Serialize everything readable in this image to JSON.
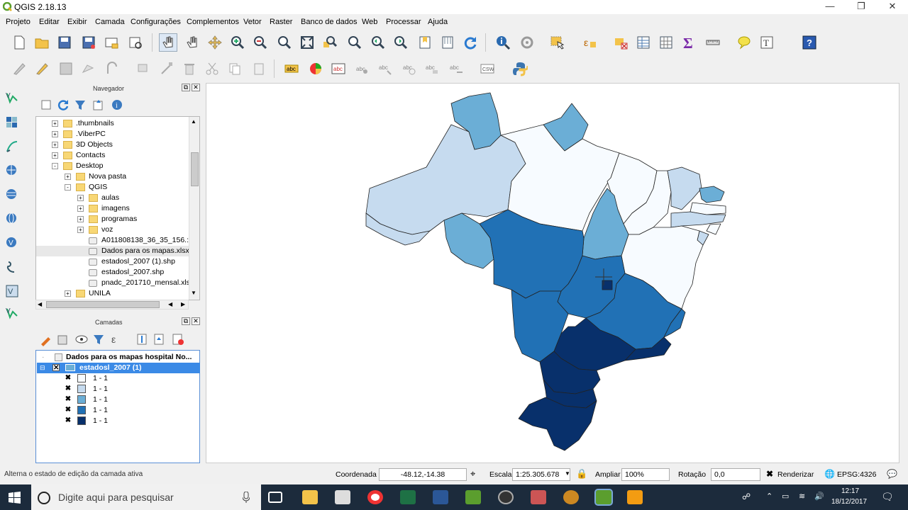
{
  "window": {
    "title": "QGIS 2.18.13"
  },
  "menu": [
    "Projeto",
    "Editar",
    "Exibir",
    "Camada",
    "Configurações",
    "Complementos",
    "Vetor",
    "Raster",
    "Banco de dados",
    "Web",
    "Processar",
    "Ajuda"
  ],
  "navigator": {
    "title": "Navegador",
    "items": [
      {
        "label": ".thumbnails",
        "level": 1,
        "type": "folder",
        "exp": "+"
      },
      {
        "label": ".ViberPC",
        "level": 1,
        "type": "folder",
        "exp": "+"
      },
      {
        "label": "3D Objects",
        "level": 1,
        "type": "folder",
        "exp": "+"
      },
      {
        "label": "Contacts",
        "level": 1,
        "type": "folder",
        "exp": "+"
      },
      {
        "label": "Desktop",
        "level": 1,
        "type": "folder",
        "exp": "-"
      },
      {
        "label": "Nova pasta",
        "level": 2,
        "type": "folder",
        "exp": "+"
      },
      {
        "label": "QGIS",
        "level": 2,
        "type": "folder",
        "exp": "-"
      },
      {
        "label": "aulas",
        "level": 3,
        "type": "folder",
        "exp": "+"
      },
      {
        "label": "imagens",
        "level": 3,
        "type": "folder",
        "exp": "+"
      },
      {
        "label": "programas",
        "level": 3,
        "type": "folder",
        "exp": "+"
      },
      {
        "label": "voz",
        "level": 3,
        "type": "folder",
        "exp": "+"
      },
      {
        "label": "A011808138_36_35_156.:",
        "level": 3,
        "type": "file"
      },
      {
        "label": "Dados para os mapas.xlsx",
        "level": 3,
        "type": "file",
        "selected": true
      },
      {
        "label": "estadosl_2007 (1).shp",
        "level": 3,
        "type": "file"
      },
      {
        "label": "estadosl_2007.shp",
        "level": 3,
        "type": "file"
      },
      {
        "label": "pnadc_201710_mensal.xls",
        "level": 3,
        "type": "file"
      },
      {
        "label": "UNILA",
        "level": 2,
        "type": "folder",
        "exp": "+"
      }
    ]
  },
  "layers_panel": {
    "title": "Camadas",
    "layer1": "Dados para os mapas hospital No...",
    "layer2": "estadosl_2007 (1)",
    "classes": [
      {
        "label": "1 - 1",
        "color": "#f7fbff"
      },
      {
        "label": "1 - 1",
        "color": "#c6dbef"
      },
      {
        "label": "1 - 1",
        "color": "#6baed6"
      },
      {
        "label": "1 - 1",
        "color": "#2171b5"
      },
      {
        "label": "1 - 1",
        "color": "#08306b"
      }
    ]
  },
  "status": {
    "hint": "Alterna o estado de edição da camada ativa",
    "coord_label": "Coordenada",
    "coord_value": "-48.12,-14.38",
    "scale_label": "Escala",
    "scale_value": "1:25.305.678",
    "zoom_label": "Ampliar",
    "zoom_value": "100%",
    "rot_label": "Rotação",
    "rot_value": "0,0",
    "render_label": "Renderizar",
    "crs": "EPSG:4326"
  },
  "taskbar": {
    "search_placeholder": "Digite aqui para pesquisar",
    "time": "12:17",
    "date": "18/12/2017"
  },
  "colors": {
    "c1": "#f7fbff",
    "c2": "#c6dbef",
    "c3": "#6baed6",
    "c4": "#2171b5",
    "c5": "#08306b"
  }
}
